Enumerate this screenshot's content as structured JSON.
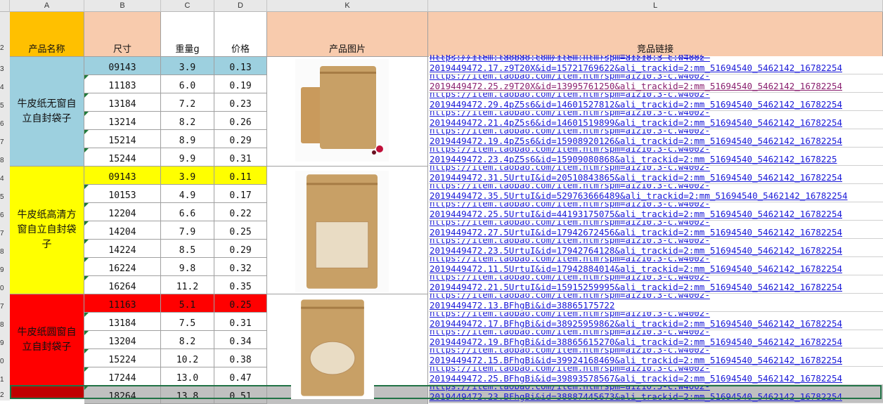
{
  "columns": [
    "A",
    "B",
    "C",
    "D",
    "K",
    "L"
  ],
  "header": {
    "name": "产品名称",
    "size": "尺寸",
    "weight": "重量g",
    "price": "价格",
    "image": "产品图片",
    "link": "竞品链接"
  },
  "row_numbers": [
    "2",
    "3",
    "4",
    "5",
    "6",
    "7",
    "8",
    "4",
    "5",
    "6",
    "7",
    "8",
    "9",
    "0",
    "7",
    "8",
    "9",
    "0",
    "1",
    "2"
  ],
  "groups": [
    {
      "name": "牛皮纸无窗自立自封袋子",
      "color": "#9dd0df"
    },
    {
      "name": "牛皮纸高清方窗自立自封袋子",
      "color": "#ffff00"
    },
    {
      "name": "牛皮纸圆窗自立自封袋子",
      "color": "#ff0000"
    }
  ],
  "rows": [
    {
      "size": "09143",
      "weight": "3.9",
      "price": "0.13",
      "link": "2019449472.17.z9T20X&id=15721769622&ali_trackid=2:mm_51694540_5462142_16782254"
    },
    {
      "size": "11183",
      "weight": "6.0",
      "price": "0.19",
      "link": "2019449472.25.z9T20X&id=13995761250&ali_trackid=2:mm_51694540_5462142_16782254"
    },
    {
      "size": "13184",
      "weight": "7.2",
      "price": "0.23",
      "link": "2019449472.29.4pZ5s6&id=14601527812&ali_trackid=2:mm_51694540_5462142_16782254"
    },
    {
      "size": "13214",
      "weight": "8.2",
      "price": "0.26",
      "link": "2019449472.21.4pZ5s6&id=14601519899&ali_trackid=2:mm_51694540_5462142_16782254"
    },
    {
      "size": "15214",
      "weight": "8.9",
      "price": "0.29",
      "link": "2019449472.19.4pZ5s6&id=15908920126&ali_trackid=2:mm_51694540_5462142_16782254"
    },
    {
      "size": "15244",
      "weight": "9.9",
      "price": "0.31",
      "link": "2019449472.23.4pZ5s6&id=15909080868&ali_trackid=2:mm_51694540_5462142_1678225"
    },
    {
      "size": "09143",
      "weight": "3.9",
      "price": "0.11",
      "link": "2019449472.31.5UrtuI&id=20510843865&ali_trackid=2:mm_51694540_5462142_16782254"
    },
    {
      "size": "10153",
      "weight": "4.9",
      "price": "0.17",
      "link": "2019449472.35.5UrtuI&id=529763666489&ali_trackid=2:mm_51694540_5462142_16782254"
    },
    {
      "size": "12204",
      "weight": "6.6",
      "price": "0.22",
      "link": "2019449472.25.5UrtuI&id=44193175075&ali_trackid=2:mm_51694540_5462142_16782254"
    },
    {
      "size": "14204",
      "weight": "7.9",
      "price": "0.25",
      "link": "2019449472.27.5UrtuI&id=17942672456&ali_trackid=2:mm_51694540_5462142_16782254"
    },
    {
      "size": "14224",
      "weight": "8.5",
      "price": "0.29",
      "link": "2019449472.23.5UrtuI&id=17942764128&ali_trackid=2:mm_51694540_5462142_16782254"
    },
    {
      "size": "16224",
      "weight": "9.8",
      "price": "0.32",
      "link": "2019449472.11.5UrtuI&id=17942884014&ali_trackid=2:mm_51694540_5462142_16782254"
    },
    {
      "size": "16264",
      "weight": "11.2",
      "price": "0.35",
      "link": "2019449472.21.5UrtuI&id=15915259995&ali_trackid=2:mm_51694540_5462142_16782254"
    },
    {
      "size": "11163",
      "weight": "5.1",
      "price": "0.25",
      "link": "2019449472.13.BFhgBi&id=38865175722"
    },
    {
      "size": "13184",
      "weight": "7.5",
      "price": "0.31",
      "link": "2019449472.17.BFhgBi&id=38925959862&ali_trackid=2:mm_51694540_5462142_16782254"
    },
    {
      "size": "13204",
      "weight": "8.2",
      "price": "0.34",
      "link": "2019449472.19.BFhgBi&id=38865615270&ali_trackid=2:mm_51694540_5462142_16782254"
    },
    {
      "size": "15224",
      "weight": "10.2",
      "price": "0.38",
      "link": "2019449472.15.BFhgBi&id=39924168469&ali_trackid=2:mm_51694540_5462142_16782254"
    },
    {
      "size": "17244",
      "weight": "13.0",
      "price": "0.47",
      "link": "2019449472.25.BFhgBi&id=39893578567&ali_trackid=2:mm_51694540_5462142_16782254"
    },
    {
      "size": "18264",
      "weight": "13.8",
      "price": "0.51",
      "link": "2019449472.23.BFhgBi&id=38887445673&ali_trackid=2:mm_51694540_5462142_16782254"
    }
  ],
  "link_prefix": "https://item.taobao.com/item.htm?spm=a1z10.3-c.w4002-",
  "colors": {
    "header_orange": "#ffc000",
    "header_peach": "#f8cbad",
    "row_highlight_blue": "#9dd0df",
    "row_highlight_yellow": "#ffff00",
    "row_highlight_red": "#ff0000",
    "row_selected": "#c0c0c0",
    "link": "#1a1ad8",
    "kraft": "#c8a066"
  }
}
